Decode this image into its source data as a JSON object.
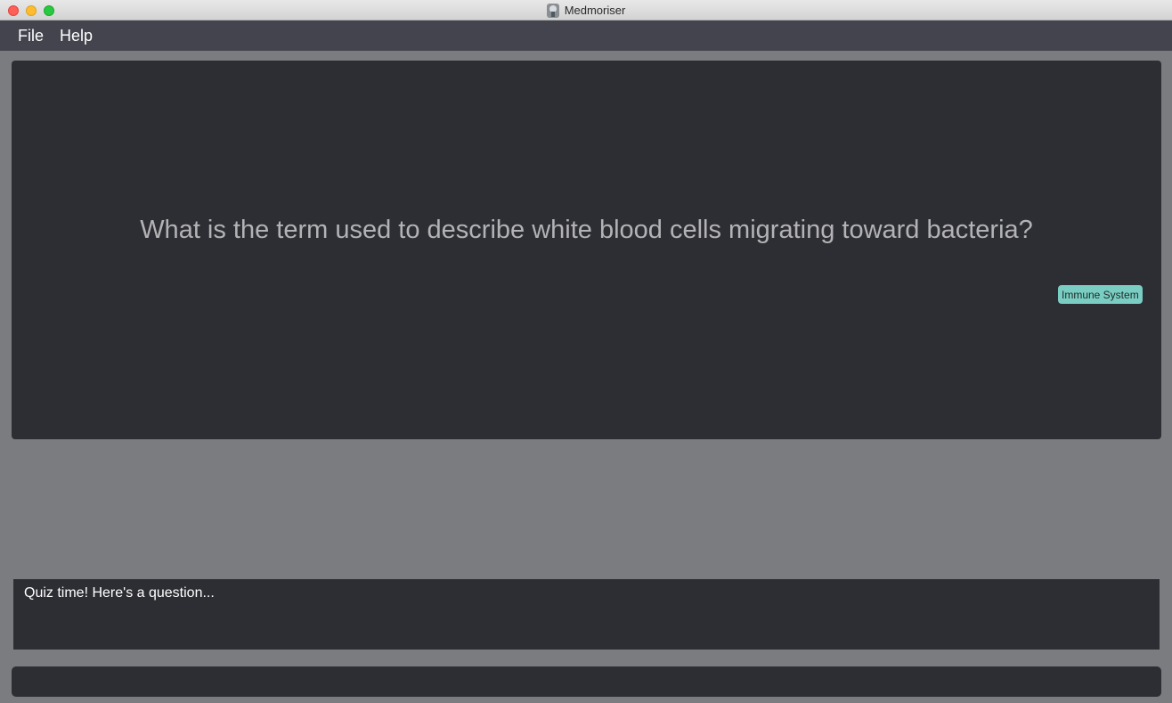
{
  "window": {
    "title": "Medmoriser"
  },
  "menu": {
    "file": "File",
    "help": "Help"
  },
  "question_card": {
    "question": "What is the term used to describe white blood cells migrating toward bacteria?",
    "tag": "Immune System"
  },
  "result": {
    "message": "Quiz time! Here's a question..."
  },
  "command": {
    "value": "",
    "placeholder": ""
  },
  "colors": {
    "background": "#7b7c80",
    "menubar": "#43444d",
    "panel": "#2d2e33",
    "tag": "#7acdc2"
  }
}
